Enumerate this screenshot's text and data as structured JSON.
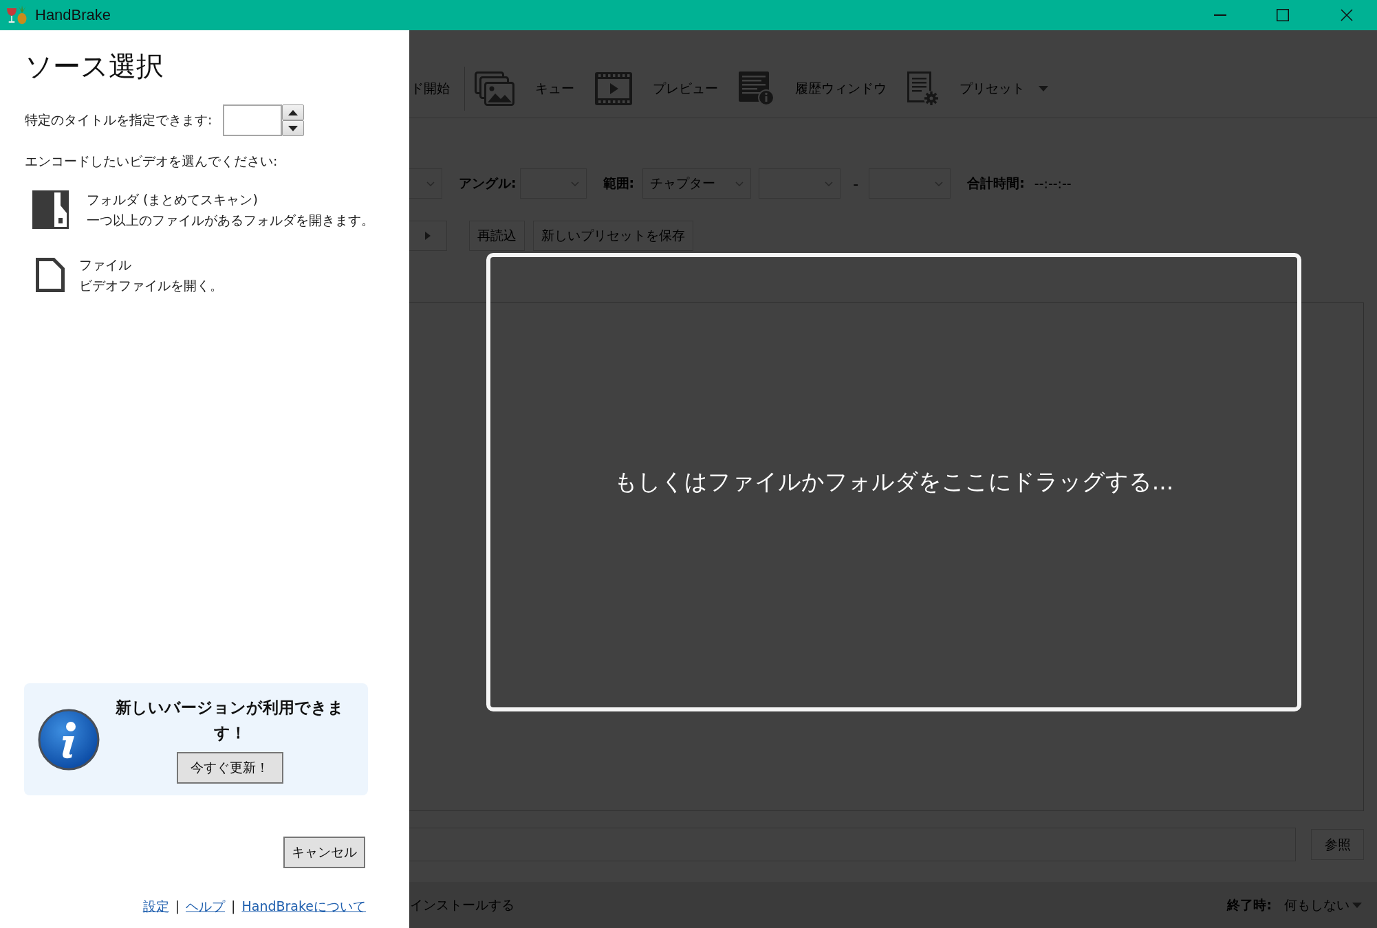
{
  "window": {
    "title": "HandBrake"
  },
  "source_panel": {
    "title": "ソース選択",
    "title_picker": {
      "label": "特定のタイトルを指定できます:"
    },
    "prompt": "エンコードしたいビデオを選んでください:",
    "options": [
      {
        "kind": "folder",
        "name": "フォルダ (まとめてスキャン)",
        "description": "一つ以上のファイルがあるフォルダを開きます。"
      },
      {
        "kind": "file",
        "name": "ファイル",
        "description": "ビデオファイルを開く。"
      }
    ],
    "update_notice": {
      "message": "新しいバージョンが利用できます！",
      "button": "今すぐ更新！"
    },
    "cancel_button": "キャンセル",
    "footer": [
      {
        "kind": "link",
        "text": "設定"
      },
      {
        "kind": "separator",
        "text": "|"
      },
      {
        "kind": "link",
        "text": "ヘルプ"
      },
      {
        "kind": "separator",
        "text": "|"
      },
      {
        "kind": "link",
        "text": "HandBrakeについて"
      }
    ]
  },
  "main_window": {
    "toolbar": [
      {
        "kind": "start",
        "label": "ド開始",
        "dropdown": false
      },
      {
        "kind": "queue",
        "label": "キュー",
        "dropdown": false
      },
      {
        "kind": "preview",
        "label": "プレビュー",
        "dropdown": false
      },
      {
        "kind": "activity",
        "label": "履歴ウィンドウ",
        "dropdown": false
      },
      {
        "kind": "presets",
        "label": "プリセット",
        "dropdown": true
      }
    ],
    "source_row": [
      {
        "kind": "dropdown"
      },
      {
        "kind": "label",
        "text": "アングル:"
      },
      {
        "kind": "dropdown"
      },
      {
        "kind": "label",
        "text": "範囲:"
      },
      {
        "kind": "dropdown",
        "value": "チャプター"
      },
      {
        "kind": "dropdown"
      },
      {
        "kind": "separator",
        "text": "-"
      },
      {
        "kind": "dropdown"
      },
      {
        "kind": "label",
        "text": "合計時間:"
      },
      {
        "kind": "value",
        "text": "--:--:--"
      }
    ],
    "action_row": [
      {
        "kind": "play"
      },
      {
        "kind": "text",
        "label": "再読込"
      },
      {
        "kind": "text",
        "label": "新しいプリセットを保存"
      }
    ],
    "drop_hint": "もしくはファイルかフォルダをここにドラッグする...",
    "destination": {
      "browse_button": "参照"
    },
    "status_bar": {
      "message": "インストールする",
      "when_done_label": "終了時:",
      "when_done_value": "何もしない"
    }
  }
}
